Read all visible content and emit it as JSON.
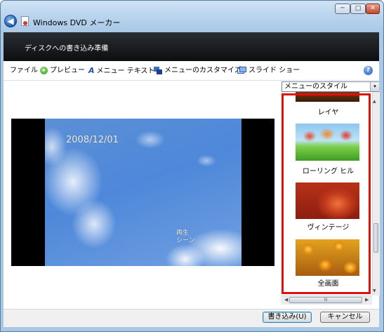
{
  "window": {
    "title": "Windows DVD メーカー",
    "header": "ディスクへの書き込み準備",
    "controls": {
      "minimize": "─",
      "maximize": "□",
      "close": "✕"
    },
    "back": "◀"
  },
  "toolbar": {
    "file": "ファイル",
    "preview": "プレビュー",
    "menu_text": "メニュー テキスト",
    "customize": "メニューのカスタマイズ",
    "slideshow": "スライド ショー",
    "help": "?",
    "menu_text_icon": "A"
  },
  "preview": {
    "date": "2008/12/01",
    "play_label_line1": "再生",
    "play_label_line2": "シーン"
  },
  "styles_panel": {
    "dropdown_value": "メニューのスタイル",
    "dropdown_arrow": "▾",
    "items": [
      {
        "label": "レイヤ"
      },
      {
        "label": "ローリング ヒル"
      },
      {
        "label": "ヴィンテージ"
      },
      {
        "label": "全画面"
      }
    ],
    "scroll": {
      "up": "▲",
      "down": "▼",
      "left": "◀",
      "right": "▶",
      "grip": "III"
    },
    "highlight_color": "#e01010"
  },
  "buttons": {
    "burn": "書き込み(U)",
    "cancel": "キャンセル"
  }
}
